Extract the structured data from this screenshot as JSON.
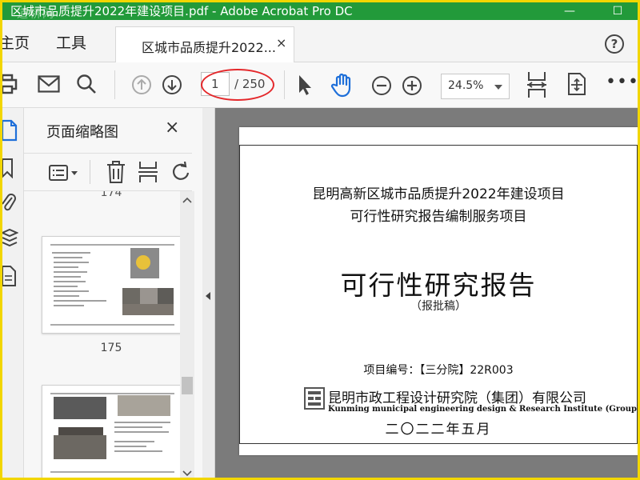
{
  "window": {
    "title": "区城市品质提升2022年建设项目.pdf - Adobe Acrobat Pro DC",
    "watermark": "道桥网",
    "minimize": "—",
    "maximize": "☐"
  },
  "menubar": {
    "home": "主页",
    "tools": "工具",
    "tab_label": "区城市品质提升2022...",
    "tab_close": "×",
    "help": "?"
  },
  "toolbar": {
    "page_current": "1",
    "page_total": "/ 250",
    "zoom": "24.5%",
    "more": "•••"
  },
  "panel": {
    "title": "页面缩略图",
    "close": "×",
    "thumb_numbers": [
      "175"
    ]
  },
  "document": {
    "title_line1": "昆明高新区城市品质提升2022年建设项目",
    "title_line2": "可行性研究报告编制服务项目",
    "main_title": "可行性研究报告",
    "subtitle": "（报批稿）",
    "project_code": "项目编号：【三分院】22R003",
    "org_name": "昆明市政工程设计研究院（集团）有限公司",
    "org_name_en": "Kunming municipal engineering design & Research Institute (Group) Co., Ltd",
    "date": "二〇二二年五月"
  },
  "colors": {
    "titlebar": "#229a3a",
    "outer_border": "#f2d600",
    "annotation_oval": "#e4282b",
    "tool_icon_blue": "#1e6fd9"
  }
}
